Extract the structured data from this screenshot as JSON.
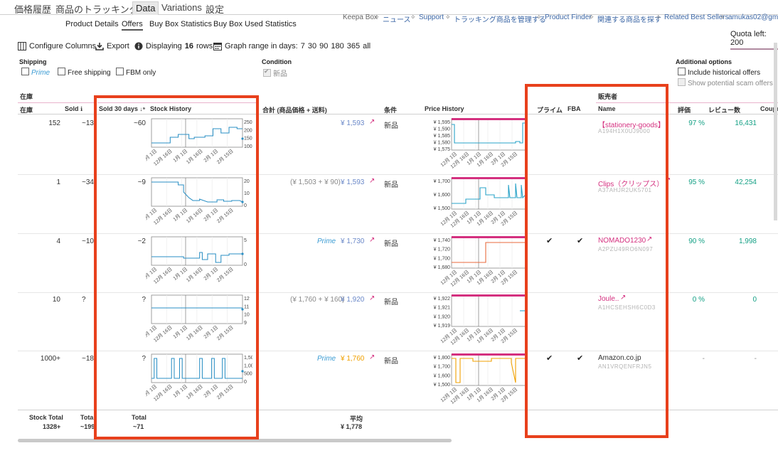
{
  "tabs": [
    "価格履歴",
    "商品のトラッキング",
    "Data",
    "Variations",
    "設定"
  ],
  "active_tab": "Data",
  "subtabs": [
    "Product Details",
    "Offers",
    "Buy Box Statistics",
    "Buy Box Used Statistics"
  ],
  "active_subtab": "Offers",
  "top_links": {
    "keepa_box": "Keepa Box",
    "news": "ニュース",
    "support": "Support",
    "manage_tracking": "トラッキング商品を管理する",
    "product_finder": "Product Finder",
    "related_search": "関連する商品を探す",
    "related_best": "Related Best Sellers",
    "user_email": "amukas02@gmail"
  },
  "quota": "Quota left: 200",
  "toolbar": {
    "configure_columns": "Configure Columns",
    "export": "Export",
    "displaying_prefix": "Displaying",
    "displaying_count": "16",
    "displaying_suffix": "rows",
    "graph_range_label": "Graph range in days:",
    "graph_range_options": [
      "7",
      "30",
      "90",
      "180",
      "365",
      "all"
    ]
  },
  "filters": {
    "shipping_title": "Shipping",
    "prime": "Prime",
    "free_shipping": "Free shipping",
    "fbm_only": "FBM only",
    "condition_title": "Condition",
    "condition_new": "新品",
    "additional_title": "Additional options",
    "include_historical": "Include historical offers",
    "show_scam": "Show potential scam offers"
  },
  "group_headers": {
    "stock": "在庫",
    "seller": "販売者"
  },
  "columns": {
    "stock": "在庫",
    "sold": "Sold",
    "sold30": "Sold 30 days",
    "stock_history": "Stock History",
    "total_price": "合計 (商品価格 + 送料)",
    "condition": "条件",
    "price_history": "Price History",
    "prime": "プライム",
    "fba": "FBA",
    "name": "Name",
    "rating": "評価",
    "review_count": "レビュー数",
    "coupon": "Coupo"
  },
  "stock_x_ticks": [
    "12月 1日",
    "12月 16日",
    "1月 1日",
    "1月 16日",
    "2月 1日",
    "2月 15日"
  ],
  "rows": [
    {
      "stock": "152",
      "sold": "~137",
      "sold30": "~60",
      "stock_ticks": [
        "250",
        "200",
        "150",
        "100"
      ],
      "price_detail": "",
      "price_prefix": "",
      "price": "¥ 1,593",
      "condition": "新品",
      "price_ticks": [
        "¥ 1,595",
        "¥ 1,590",
        "¥ 1,585",
        "¥ 1,580",
        "¥ 1,575"
      ],
      "prime_check": "",
      "fba_check": "",
      "seller": "【stationery-goods】",
      "seller_id": "A194H1X0UJ9000",
      "rating": "97 %",
      "reviews": "16,431"
    },
    {
      "stock": "1",
      "sold": "~34",
      "sold30": "~9",
      "stock_ticks": [
        "20",
        "10",
        "0"
      ],
      "price_detail": "(¥ 1,503 + ¥ 90)",
      "price_prefix": "",
      "price": "¥ 1,593",
      "condition": "新品",
      "price_ticks": [
        "¥ 1,700",
        "¥ 1,600",
        "¥ 1,500"
      ],
      "prime_check": "",
      "fba_check": "",
      "seller": "Clips（クリップス）",
      "seller_id": "A37AHJR2UK5701",
      "rating": "95 %",
      "reviews": "42,254"
    },
    {
      "stock": "4",
      "sold": "~10",
      "sold30": "~2",
      "stock_ticks": [
        "5",
        "0"
      ],
      "price_detail": "",
      "price_prefix": "Prime",
      "price": "¥ 1,730",
      "condition": "新品",
      "price_ticks": [
        "¥ 1,740",
        "¥ 1,720",
        "¥ 1,700",
        "¥ 1,680"
      ],
      "prime_check": "✔",
      "fba_check": "✔",
      "seller": "NOMADO1230",
      "seller_id": "A2PZU49RO6N097",
      "rating": "90 %",
      "reviews": "1,998"
    },
    {
      "stock": "10",
      "sold": "?",
      "sold30": "?",
      "stock_ticks": [
        "12",
        "11",
        "10",
        "9"
      ],
      "price_detail": "(¥ 1,760 + ¥ 160)",
      "price_prefix": "",
      "price": "¥ 1,920",
      "condition": "新品",
      "price_ticks": [
        "¥ 1,922",
        "¥ 1,921",
        "¥ 1,920",
        "¥ 1,919"
      ],
      "prime_check": "",
      "fba_check": "",
      "seller": "Joule..",
      "seller_id": "A1HCSEHSH6C0D3",
      "rating": "0 %",
      "reviews": "0"
    },
    {
      "stock": "1000+",
      "sold": "~18",
      "sold30": "?",
      "stock_ticks": [
        "1,500",
        "1,000",
        "500",
        "0"
      ],
      "price_detail": "",
      "price_prefix": "Prime",
      "price": "¥ 1,760",
      "condition": "新品",
      "price_ticks": [
        "¥ 1,800",
        "¥ 1,700",
        "¥ 1,600",
        "¥ 1,500"
      ],
      "prime_check": "✔",
      "fba_check": "✔",
      "seller": "Amazon.co.jp",
      "seller_id": "AN1VRQENFRJN5",
      "rating": "-",
      "reviews": "-"
    }
  ],
  "footer": {
    "stock_total_label": "Stock Total",
    "stock_total_value": "1328+",
    "total_label": "Total",
    "total_value": "~199",
    "total30_label": "Total",
    "total30_value": "~71",
    "avg_label": "平均",
    "avg_value": "¥ 1,778"
  },
  "colors": {
    "accent_pink": "#d4307f",
    "rating_green": "#14a085",
    "stock_line": "#2a8fc4",
    "price_line_blue": "#2aa3c8",
    "price_line_orange": "#e86a3c",
    "price_line_amber": "#f0a000",
    "highlight_red": "#e8401c"
  }
}
